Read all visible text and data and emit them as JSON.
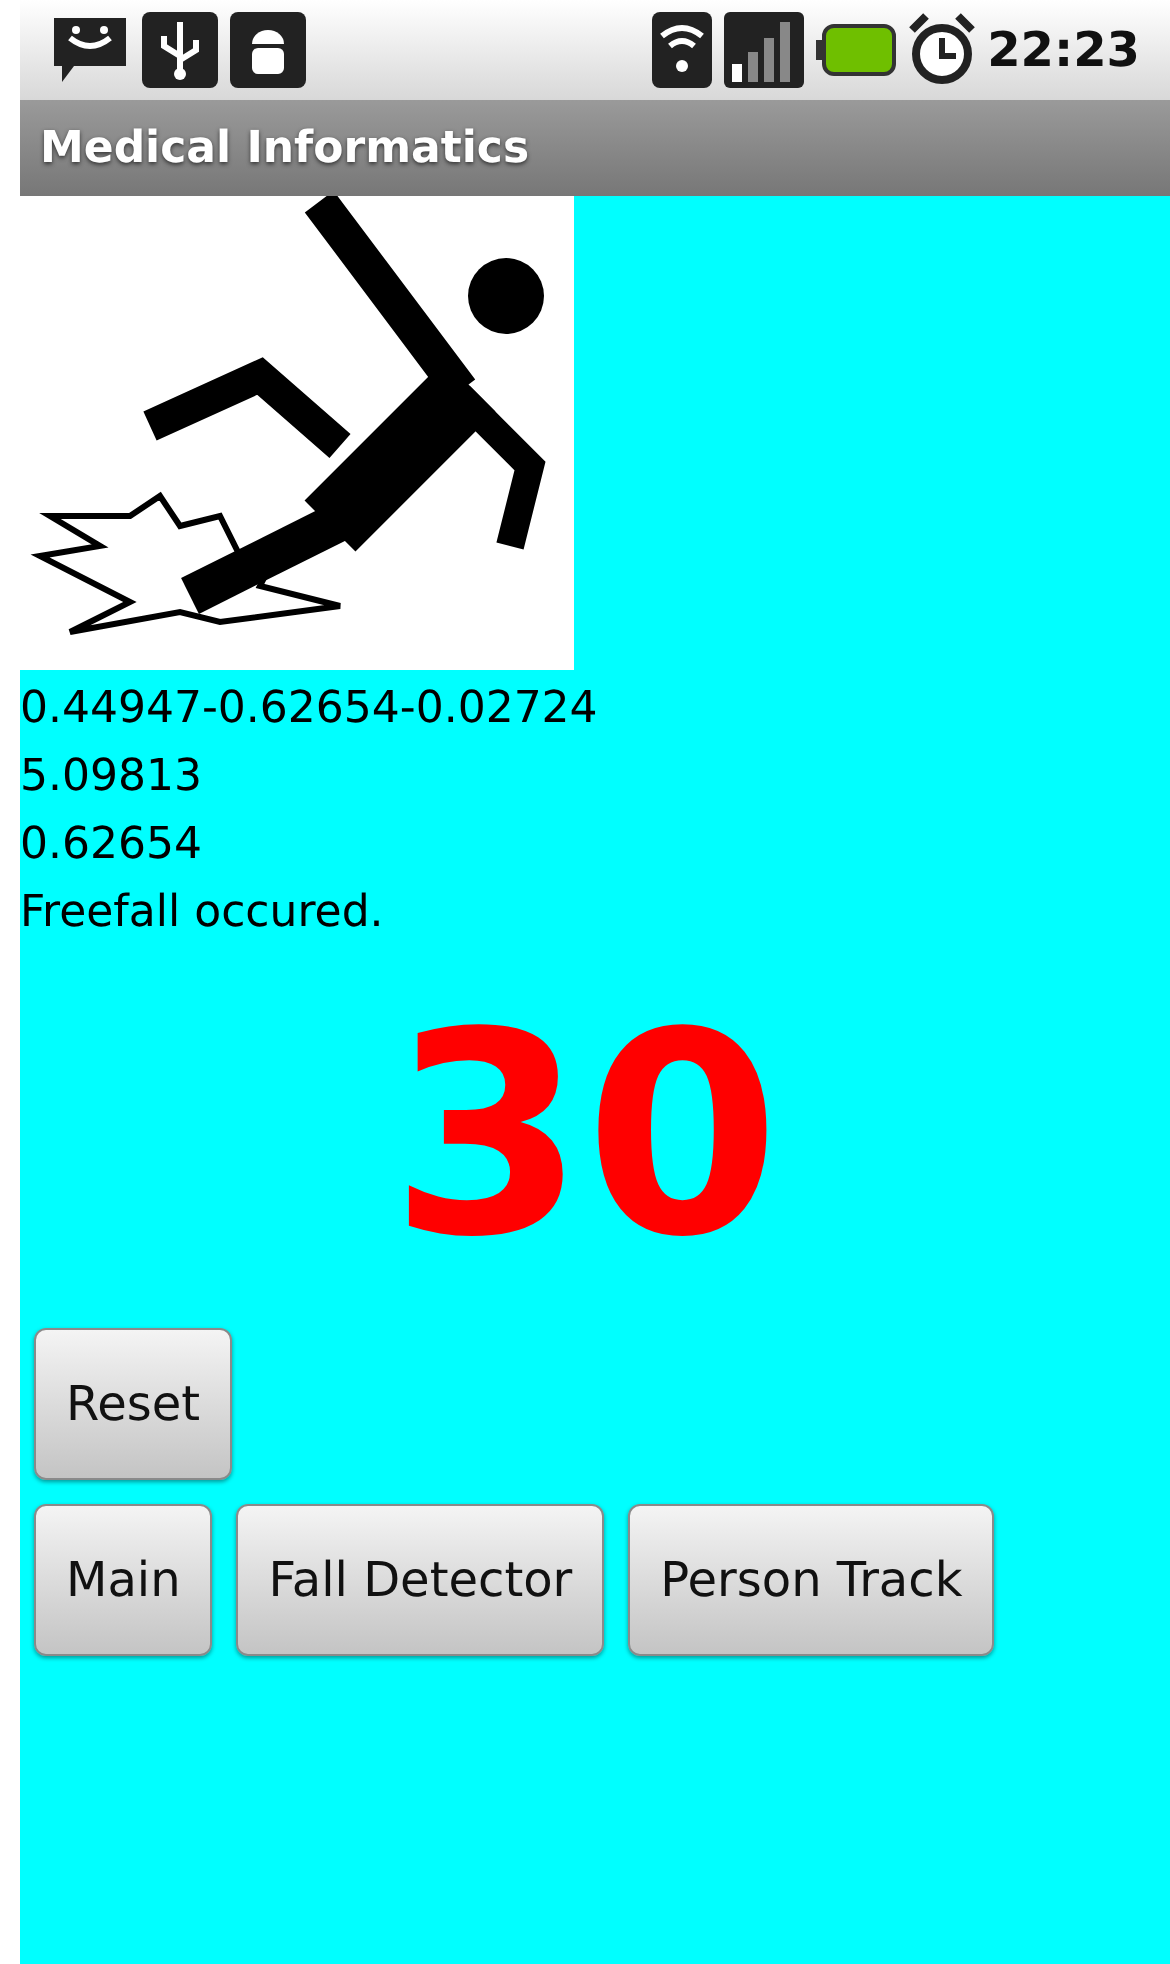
{
  "status_bar": {
    "time": "22:23"
  },
  "title_bar": {
    "title": "Medical Informatics"
  },
  "readings": [
    "0.44947-0.62654-0.02724",
    "5.09813",
    "0.62654",
    "Freefall occured."
  ],
  "counter": "30",
  "reset_button": "Reset",
  "nav_buttons": [
    "Main",
    "Fall Detector",
    "Person Track"
  ]
}
